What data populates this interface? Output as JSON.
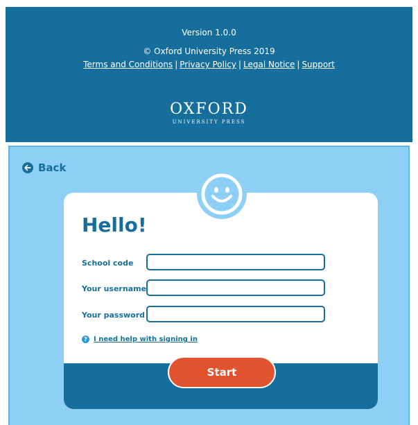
{
  "footer": {
    "version": "Version 1.0.0",
    "copyright": "© Oxford University Press 2019",
    "links": {
      "terms": "Terms and Conditions",
      "privacy": "Privacy Policy",
      "legal": "Legal Notice",
      "support": "Support",
      "separator": "|"
    },
    "logo": {
      "word": "OXFORD",
      "sub": "UNIVERSITY PRESS"
    }
  },
  "login": {
    "back_label": "Back",
    "greeting": "Hello!",
    "fields": {
      "school_code": {
        "label": "School code",
        "value": ""
      },
      "username": {
        "label": "Your username",
        "value": ""
      },
      "password": {
        "label": "Your password",
        "value": ""
      }
    },
    "help_label": "I need help with signing in",
    "help_icon": "?",
    "start_label": "Start"
  },
  "colors": {
    "brand_dark": "#156e9b",
    "panel_light": "#8ecff6",
    "start_button": "#e1532e",
    "help_icon": "#2e9bd6"
  },
  "icons": [
    "back-arrow-icon",
    "smiley-icon",
    "help-icon"
  ]
}
